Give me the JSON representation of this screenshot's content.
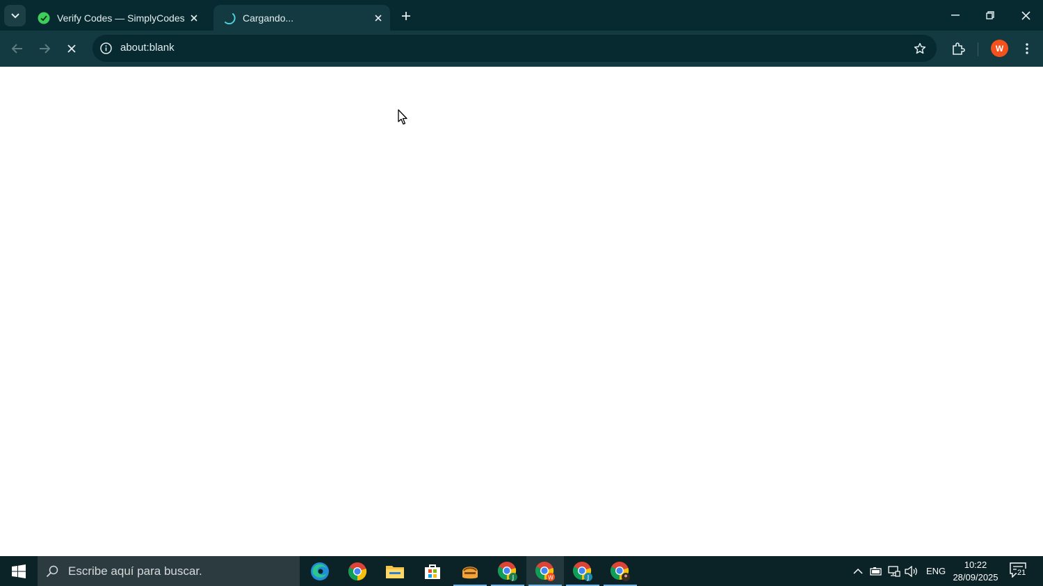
{
  "browser": {
    "tabs": [
      {
        "title": "Verify Codes — SimplyCodes",
        "active": false
      },
      {
        "title": "Cargando...",
        "active": true
      }
    ],
    "address_bar": {
      "url": "about:blank"
    },
    "profile": {
      "initial": "W",
      "color": "#f4511e"
    },
    "colors": {
      "frame": "#062a30",
      "toolbar": "#123a40",
      "accent": "#4fd1d9"
    }
  },
  "taskbar": {
    "search_placeholder": "Escribe aquí para buscar.",
    "apps": [
      {
        "name": "edge-icon"
      },
      {
        "name": "chrome-icon"
      },
      {
        "name": "file-explorer-icon"
      },
      {
        "name": "microsoft-store-icon"
      },
      {
        "name": "game-app-icon"
      },
      {
        "name": "chrome-profile-j-icon"
      },
      {
        "name": "chrome-profile-w-icon"
      },
      {
        "name": "chrome-profile-j2-icon"
      },
      {
        "name": "chrome-profile-photo-icon"
      }
    ],
    "tray": {
      "language": "ENG",
      "time": "10:22",
      "date": "28/09/2025",
      "notification_count": "21"
    }
  }
}
